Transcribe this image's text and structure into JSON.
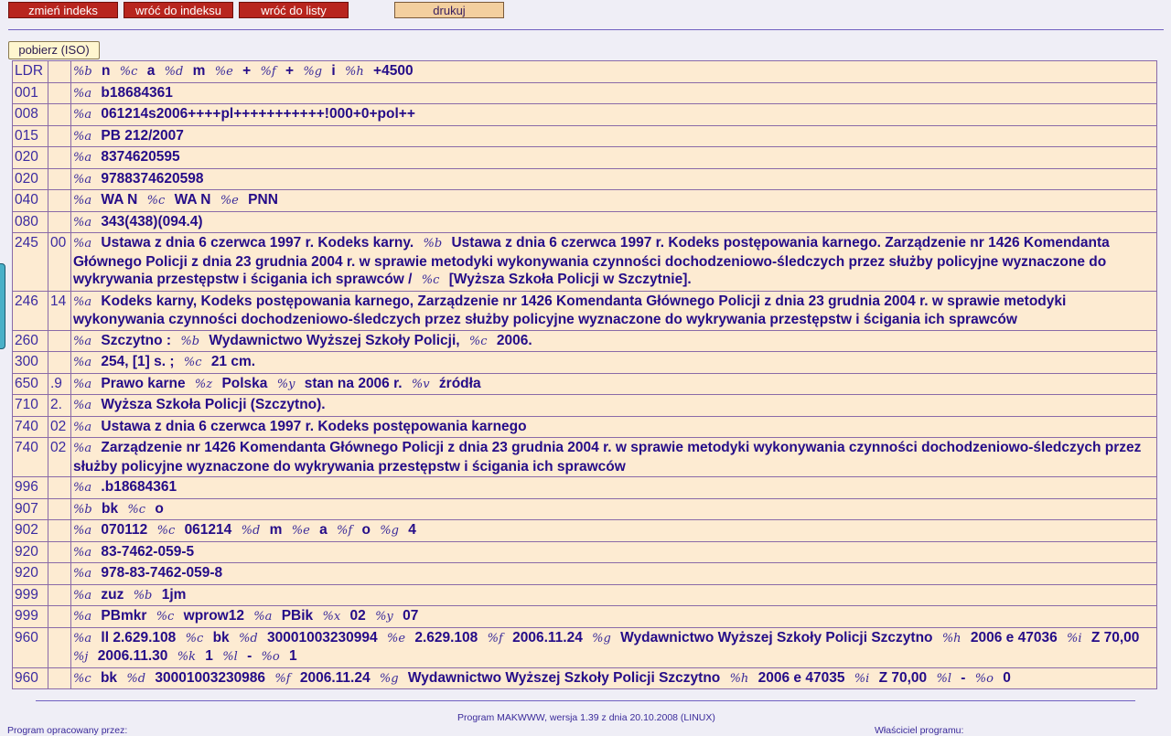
{
  "toolbar": {
    "change_index": "zmień indeks",
    "back_to_index": "wróć do indeksu",
    "back_to_list": "wróć do listy",
    "print": "drukuj"
  },
  "download_iso": "pobierz (ISO)",
  "records": [
    {
      "tag": "LDR",
      "ind": "",
      "parts": [
        [
          "b",
          "n"
        ],
        [
          "c",
          "a"
        ],
        [
          "d",
          "m"
        ],
        [
          "e",
          "+"
        ],
        [
          "f",
          "+"
        ],
        [
          "g",
          "i"
        ],
        [
          "h",
          "+4500"
        ]
      ]
    },
    {
      "tag": "001",
      "ind": "",
      "parts": [
        [
          "a",
          "b18684361"
        ]
      ]
    },
    {
      "tag": "008",
      "ind": "",
      "parts": [
        [
          "a",
          "061214s2006++++pl+++++++++++!000+0+pol++"
        ]
      ]
    },
    {
      "tag": "015",
      "ind": "",
      "parts": [
        [
          "a",
          "PB 212/2007"
        ]
      ]
    },
    {
      "tag": "020",
      "ind": "",
      "parts": [
        [
          "a",
          "8374620595"
        ]
      ]
    },
    {
      "tag": "020",
      "ind": "",
      "parts": [
        [
          "a",
          "9788374620598"
        ]
      ]
    },
    {
      "tag": "040",
      "ind": "",
      "parts": [
        [
          "a",
          "WA N"
        ],
        [
          "c",
          "WA N"
        ],
        [
          "e",
          "PNN"
        ]
      ]
    },
    {
      "tag": "080",
      "ind": "",
      "parts": [
        [
          "a",
          "343(438)(094.4)"
        ]
      ]
    },
    {
      "tag": "245",
      "ind": "00",
      "parts": [
        [
          "a",
          "Ustawa z dnia 6 czerwca 1997 r. Kodeks karny."
        ],
        [
          "b",
          "Ustawa z dnia 6 czerwca 1997 r. Kodeks postępowania karnego. Zarządzenie nr 1426 Komendanta Głównego Policji z dnia 23 grudnia 2004 r. w sprawie metodyki wykonywania czynności dochodzeniowo-śledczych przez służby policyjne wyznaczone do wykrywania przestępstw i ścigania ich sprawców /"
        ],
        [
          "c",
          "[Wyższa Szkoła Policji w Szczytnie]."
        ]
      ]
    },
    {
      "tag": "246",
      "ind": "14",
      "parts": [
        [
          "a",
          "Kodeks karny, Kodeks postępowania karnego, Zarządzenie nr 1426 Komendanta Głównego Policji z dnia 23 grudnia 2004 r. w sprawie metodyki wykonywania czynności dochodzeniowo-śledczych przez służby policyjne wyznaczone do wykrywania przestępstw i ścigania ich sprawców"
        ]
      ]
    },
    {
      "tag": "260",
      "ind": "",
      "parts": [
        [
          "a",
          "Szczytno :"
        ],
        [
          "b",
          "Wydawnictwo Wyższej Szkoły Policji,"
        ],
        [
          "c",
          "2006."
        ]
      ]
    },
    {
      "tag": "300",
      "ind": "",
      "parts": [
        [
          "a",
          "254, [1] s. ;"
        ],
        [
          "c",
          "21 cm."
        ]
      ]
    },
    {
      "tag": "650",
      "ind": ".9",
      "parts": [
        [
          "a",
          "Prawo karne"
        ],
        [
          "z",
          "Polska"
        ],
        [
          "y",
          "stan na 2006 r."
        ],
        [
          "v",
          "źródła"
        ]
      ]
    },
    {
      "tag": "710",
      "ind": "2.",
      "parts": [
        [
          "a",
          "Wyższa Szkoła Policji (Szczytno)."
        ]
      ]
    },
    {
      "tag": "740",
      "ind": "02",
      "parts": [
        [
          "a",
          "Ustawa z dnia 6 czerwca 1997 r. Kodeks postępowania karnego"
        ]
      ]
    },
    {
      "tag": "740",
      "ind": "02",
      "parts": [
        [
          "a",
          "Zarządzenie nr 1426 Komendanta Głównego Policji z dnia 23 grudnia 2004 r. w sprawie metodyki wykonywania czynności dochodzeniowo-śledczych przez służby policyjne wyznaczone do wykrywania przestępstw i ścigania ich sprawców"
        ]
      ]
    },
    {
      "tag": "996",
      "ind": "",
      "parts": [
        [
          "a",
          ".b18684361"
        ]
      ]
    },
    {
      "tag": "907",
      "ind": "",
      "parts": [
        [
          "b",
          "bk"
        ],
        [
          "c",
          "o"
        ]
      ]
    },
    {
      "tag": "902",
      "ind": "",
      "parts": [
        [
          "a",
          "070112"
        ],
        [
          "c",
          "061214"
        ],
        [
          "d",
          "m"
        ],
        [
          "e",
          "a"
        ],
        [
          "f",
          "o"
        ],
        [
          "g",
          "4"
        ]
      ]
    },
    {
      "tag": "920",
      "ind": "",
      "parts": [
        [
          "a",
          "83-7462-059-5"
        ]
      ]
    },
    {
      "tag": "920",
      "ind": "",
      "parts": [
        [
          "a",
          "978-83-7462-059-8"
        ]
      ]
    },
    {
      "tag": "999",
      "ind": "",
      "parts": [
        [
          "a",
          "zuz"
        ],
        [
          "b",
          "1jm"
        ]
      ]
    },
    {
      "tag": "999",
      "ind": "",
      "parts": [
        [
          "a",
          "PBmkr"
        ],
        [
          "c",
          "wprow12"
        ],
        [
          "a",
          "PBik"
        ],
        [
          "x",
          "02"
        ],
        [
          "y",
          "07"
        ]
      ]
    },
    {
      "tag": "960",
      "ind": "",
      "parts": [
        [
          "a",
          "ll 2.629.108"
        ],
        [
          "c",
          "bk"
        ],
        [
          "d",
          "30001003230994"
        ],
        [
          "e",
          "2.629.108"
        ],
        [
          "f",
          "2006.11.24"
        ],
        [
          "g",
          "Wydawnictwo Wyższej Szkoły Policji Szczytno"
        ],
        [
          "h",
          "2006 e 47036"
        ],
        [
          "i",
          "Z 70,00"
        ],
        [
          "j",
          "2006.11.30"
        ],
        [
          "k",
          "1"
        ],
        [
          "l",
          "-"
        ],
        [
          "o",
          "1"
        ]
      ]
    },
    {
      "tag": "960",
      "ind": "",
      "parts": [
        [
          "c",
          "bk"
        ],
        [
          "d",
          "30001003230986"
        ],
        [
          "f",
          "2006.11.24"
        ],
        [
          "g",
          "Wydawnictwo Wyższej Szkoły Policji Szczytno"
        ],
        [
          "h",
          "2006 e 47035"
        ],
        [
          "i",
          "Z 70,00"
        ],
        [
          "l",
          "-"
        ],
        [
          "o",
          "0"
        ]
      ]
    }
  ],
  "footer": {
    "program": "Program MAKWWW, wersja 1.39 z dnia 20.10.2008 (LINUX)",
    "author": "Program opracowany przez:",
    "owner": "Właściciel programu:"
  },
  "colors": {
    "background": "#efeef6",
    "button_red": "#b8251e",
    "button_print": "#f3cf9f",
    "table_bg": "#fdebd2",
    "text": "#250c88"
  }
}
